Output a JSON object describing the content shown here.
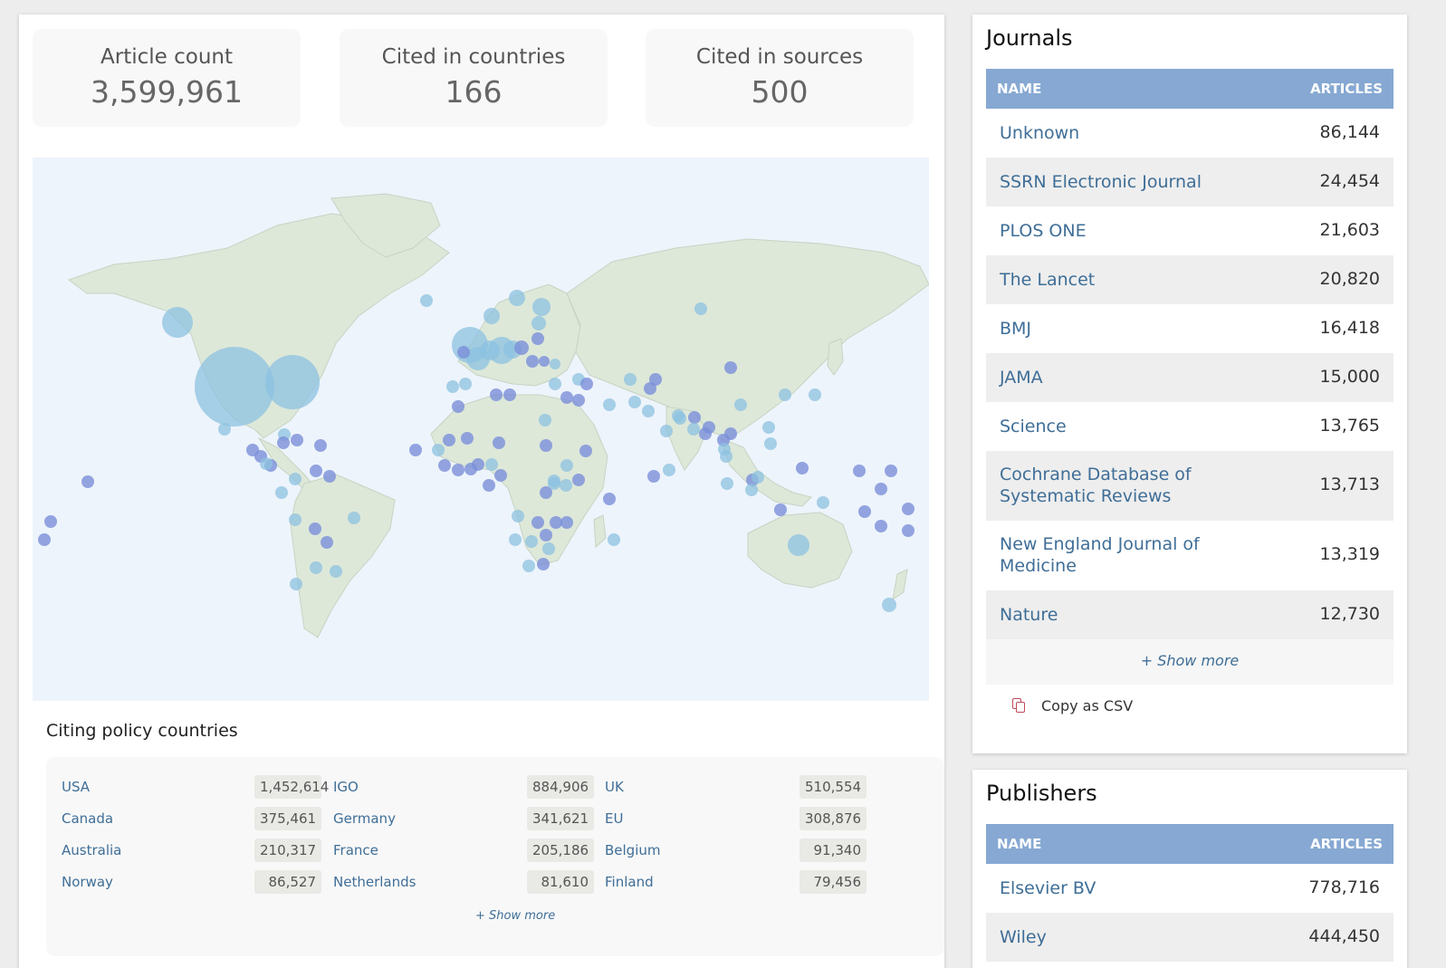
{
  "stats": [
    {
      "label": "Article count",
      "value": "3,599,961"
    },
    {
      "label": "Cited in countries",
      "value": "166"
    },
    {
      "label": "Cited in sources",
      "value": "500"
    }
  ],
  "map": {
    "land_color": "#dde8d9",
    "ocean_color": "#edf4fb",
    "bubble_color_light": "#8cc2e0",
    "bubble_color_dark": "#7b8fd9"
  },
  "countries_section": {
    "title": "Citing policy countries",
    "columns": [
      [
        {
          "name": "USA",
          "value": "1,452,614"
        },
        {
          "name": "Canada",
          "value": "375,461"
        },
        {
          "name": "Australia",
          "value": "210,317"
        },
        {
          "name": "Norway",
          "value": "86,527"
        }
      ],
      [
        {
          "name": "IGO",
          "value": "884,906"
        },
        {
          "name": "Germany",
          "value": "341,621"
        },
        {
          "name": "France",
          "value": "205,186"
        },
        {
          "name": "Netherlands",
          "value": "81,610"
        }
      ],
      [
        {
          "name": "UK",
          "value": "510,554"
        },
        {
          "name": "EU",
          "value": "308,876"
        },
        {
          "name": "Belgium",
          "value": "91,340"
        },
        {
          "name": "Finland",
          "value": "79,456"
        }
      ]
    ],
    "show_more": "+ Show more"
  },
  "journals": {
    "title": "Journals",
    "col_name": "NAME",
    "col_articles": "ARTICLES",
    "rows": [
      {
        "name": "Unknown",
        "articles": "86,144"
      },
      {
        "name": "SSRN Electronic Journal",
        "articles": "24,454"
      },
      {
        "name": "PLOS ONE",
        "articles": "21,603"
      },
      {
        "name": "The Lancet",
        "articles": "20,820"
      },
      {
        "name": "BMJ",
        "articles": "16,418"
      },
      {
        "name": "JAMA",
        "articles": "15,000"
      },
      {
        "name": "Science",
        "articles": "13,765"
      },
      {
        "name": "Cochrane Database of Systematic Reviews",
        "articles": "13,713"
      },
      {
        "name": "New England Journal of Medicine",
        "articles": "13,319"
      },
      {
        "name": "Nature",
        "articles": "12,730"
      }
    ],
    "show_more": "+ Show more",
    "copy_csv": "Copy as CSV"
  },
  "publishers": {
    "title": "Publishers",
    "col_name": "NAME",
    "col_articles": "ARTICLES",
    "rows": [
      {
        "name": "Elsevier BV",
        "articles": "778,716"
      },
      {
        "name": "Wiley",
        "articles": "444,450"
      }
    ]
  }
}
